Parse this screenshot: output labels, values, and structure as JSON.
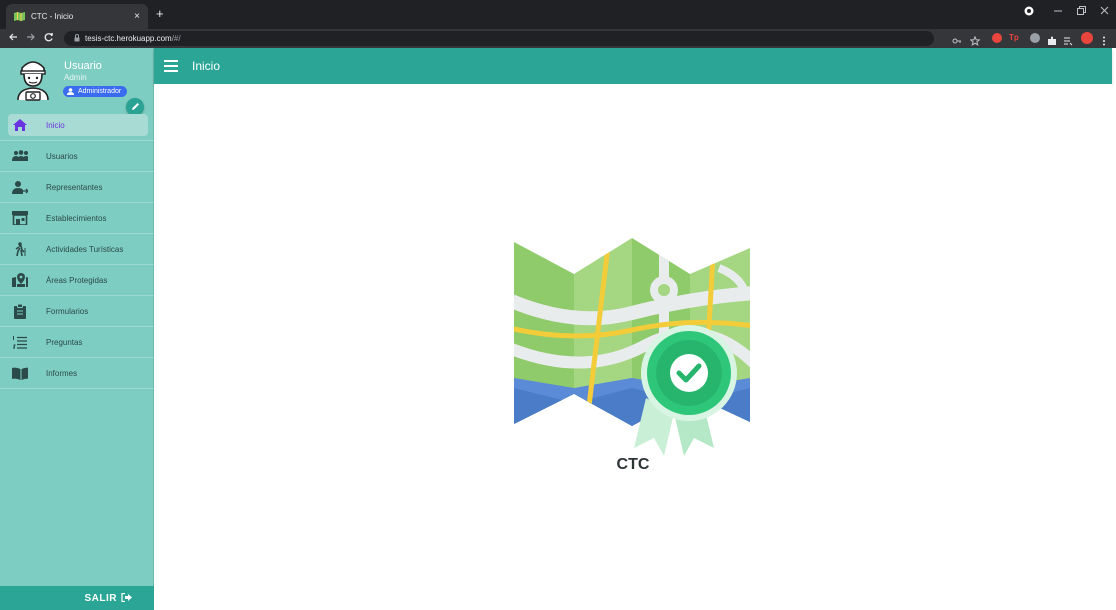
{
  "browser": {
    "tab_title": "CTC - Inicio",
    "tab_close": "×",
    "new_tab": "+",
    "url_host": "tesis-ctc.herokuapp.com",
    "url_path": "/#/"
  },
  "user": {
    "name": "Usuario",
    "role": "Admin",
    "badge": "Administrador"
  },
  "sidebar": {
    "items": [
      {
        "label": "Inicio",
        "icon": "home-icon",
        "active": true
      },
      {
        "label": "Usuarios",
        "icon": "users-icon"
      },
      {
        "label": "Representantes",
        "icon": "user-arrow-icon"
      },
      {
        "label": "Establecimientos",
        "icon": "store-icon"
      },
      {
        "label": "Actividades Turísticas",
        "icon": "hiking-icon"
      },
      {
        "label": "Áreas Protegidas",
        "icon": "map-marker-icon"
      },
      {
        "label": "Formularios",
        "icon": "clipboard-icon"
      },
      {
        "label": "Preguntas",
        "icon": "list-icon"
      },
      {
        "label": "Informes",
        "icon": "book-icon"
      }
    ],
    "logout_label": "SALIR"
  },
  "header": {
    "title": "Inicio"
  },
  "main": {
    "brand_text": "CTC"
  },
  "colors": {
    "primary": "#2ba596",
    "sidebar_bg": "#7ecdc2",
    "badge": "#3b6cf0",
    "active_text": "#6a35e0"
  }
}
